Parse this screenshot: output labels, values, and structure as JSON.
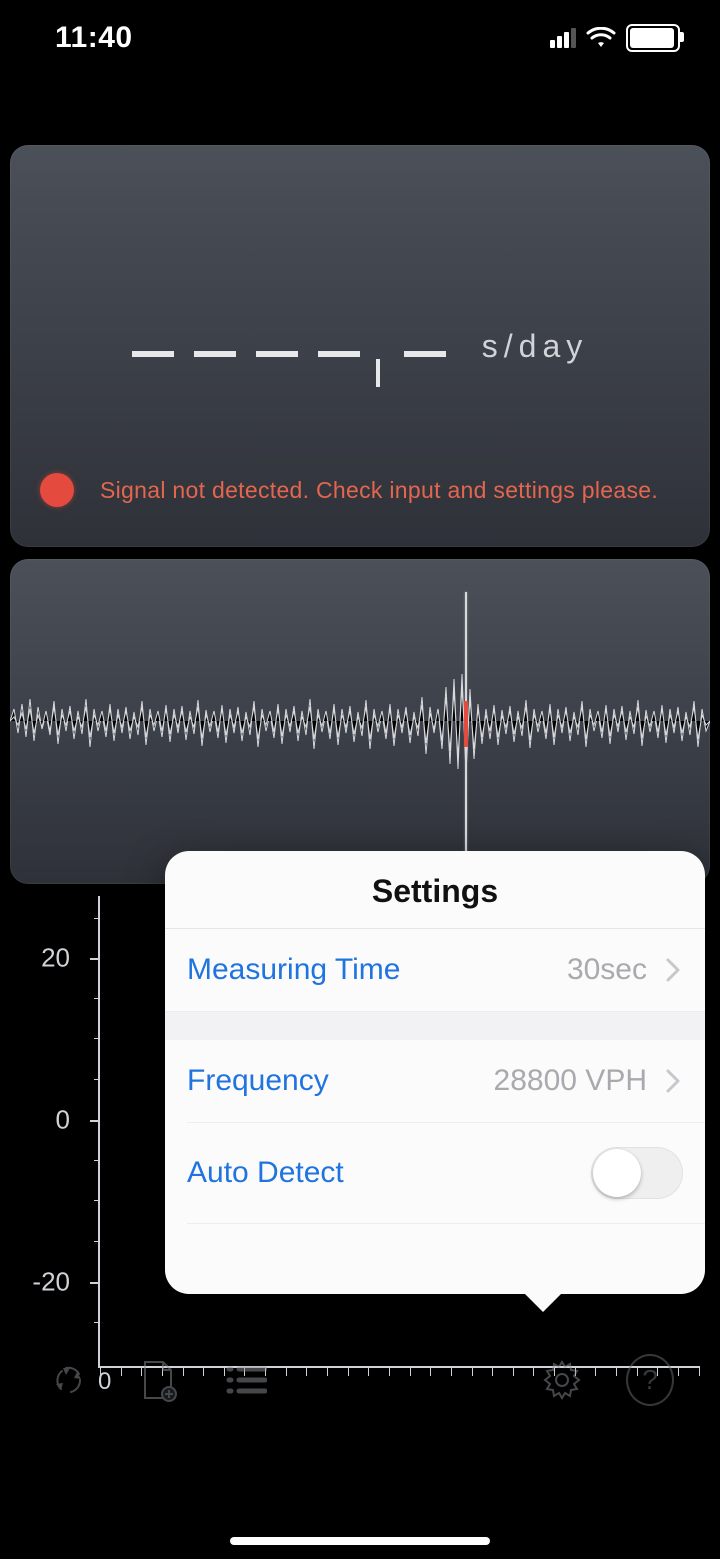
{
  "status_bar": {
    "time": "11:40"
  },
  "readout": {
    "value_display": "– – – – . –",
    "unit": "s/day",
    "status_color": "#e44a3d",
    "status_message": "Signal not detected. Check input and settings please."
  },
  "chart_data": {
    "type": "line",
    "series": [],
    "y_ticks": [
      -20,
      0,
      20
    ],
    "y_minor_step": 5,
    "ylim": [
      -30,
      30
    ],
    "x_origin_label": "0",
    "xlabel": "",
    "ylabel": ""
  },
  "popover": {
    "title": "Settings",
    "rows": {
      "measuring_time": {
        "label": "Measuring Time",
        "value": "30sec"
      },
      "frequency": {
        "label": "Frequency",
        "value": "28800 VPH"
      },
      "auto_detect": {
        "label": "Auto Detect",
        "on": false
      }
    }
  },
  "toolbar": {
    "recycle": "recycle-icon",
    "add_doc": "add-document-icon",
    "list": "list-icon",
    "settings": "gear-icon",
    "help": "?"
  }
}
